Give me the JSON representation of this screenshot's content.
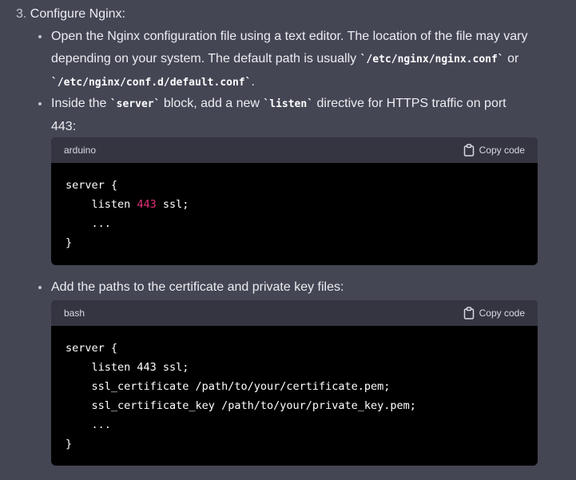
{
  "step": {
    "number": "3.",
    "title": "Configure Nginx:"
  },
  "bullet1": {
    "line1": "Open the Nginx configuration file using a text editor. The location of the file may vary",
    "line2_text": "depending on your system. The default path is usually ",
    "code1": "`/etc/nginx/nginx.conf`",
    "line2_or": " or",
    "code2": "`/etc/nginx/conf.d/default.conf`",
    "line3_end": "."
  },
  "bullet2": {
    "text1": "Inside the ",
    "code1": "`server`",
    "text2": " block, add a new ",
    "code2": "`listen`",
    "text3": " directive for HTTPS traffic on port",
    "line2": "443:"
  },
  "codeblock1": {
    "language": "arduino",
    "copy_label": "Copy code",
    "lines": {
      "l1": "server {",
      "l2_pre": "    listen ",
      "l2_num": "443",
      "l2_post": " ssl;",
      "l3": "    ...",
      "l4": "}"
    }
  },
  "bullet3": {
    "text": "Add the paths to the certificate and private key files:"
  },
  "codeblock2": {
    "language": "bash",
    "copy_label": "Copy code",
    "lines": {
      "l1": "server {",
      "l2": "    listen 443 ssl;",
      "l3": "    ssl_certificate /path/to/your/certificate.pem;",
      "l4": "    ssl_certificate_key /path/to/your/private_key.pem;",
      "l5": "    ...",
      "l6": "}"
    }
  },
  "icons": {
    "copy": "clipboard-icon"
  },
  "colors": {
    "background": "#444654",
    "code_background": "#000000",
    "code_header": "#343541",
    "number_token": "#df3079"
  }
}
